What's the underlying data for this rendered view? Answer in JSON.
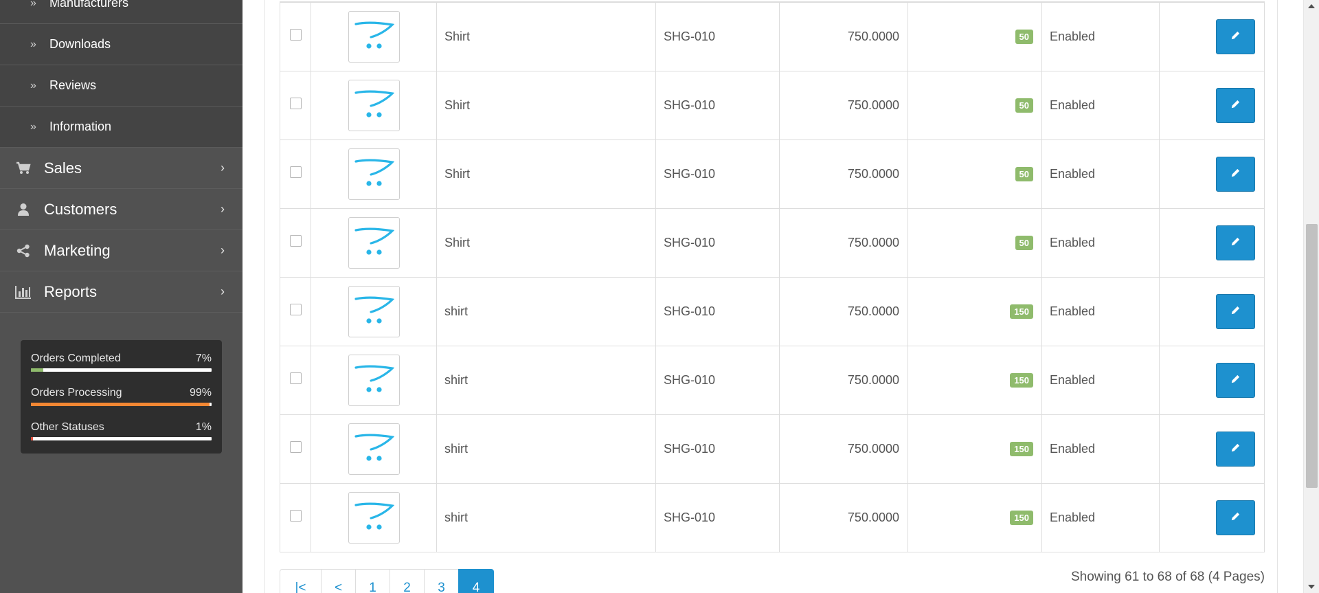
{
  "sidebar": {
    "sub_items": [
      {
        "label": "Manufacturers"
      },
      {
        "label": "Downloads"
      },
      {
        "label": "Reviews"
      },
      {
        "label": "Information"
      }
    ],
    "main_items": [
      {
        "label": "Sales",
        "icon": "shopping-cart-icon"
      },
      {
        "label": "Customers",
        "icon": "user-icon"
      },
      {
        "label": "Marketing",
        "icon": "share-icon"
      },
      {
        "label": "Reports",
        "icon": "bar-chart-icon"
      }
    ],
    "stats": [
      {
        "name": "Orders Completed",
        "pct": "7%",
        "value": 0.07,
        "color": "#8fbb6c"
      },
      {
        "name": "Orders Processing",
        "pct": "99%",
        "value": 0.99,
        "color": "#f38733"
      },
      {
        "name": "Other Statuses",
        "pct": "1%",
        "value": 0.01,
        "color": "#e3503e"
      }
    ]
  },
  "products": [
    {
      "name": "Shirt",
      "model": "SHG-010",
      "price": "750.0000",
      "quantity": "50",
      "status": "Enabled"
    },
    {
      "name": "Shirt",
      "model": "SHG-010",
      "price": "750.0000",
      "quantity": "50",
      "status": "Enabled"
    },
    {
      "name": "Shirt",
      "model": "SHG-010",
      "price": "750.0000",
      "quantity": "50",
      "status": "Enabled"
    },
    {
      "name": "Shirt",
      "model": "SHG-010",
      "price": "750.0000",
      "quantity": "50",
      "status": "Enabled"
    },
    {
      "name": "shirt",
      "model": "SHG-010",
      "price": "750.0000",
      "quantity": "150",
      "status": "Enabled"
    },
    {
      "name": "shirt",
      "model": "SHG-010",
      "price": "750.0000",
      "quantity": "150",
      "status": "Enabled"
    },
    {
      "name": "shirt",
      "model": "SHG-010",
      "price": "750.0000",
      "quantity": "150",
      "status": "Enabled"
    },
    {
      "name": "shirt",
      "model": "SHG-010",
      "price": "750.0000",
      "quantity": "150",
      "status": "Enabled"
    }
  ],
  "pagination": {
    "pages": [
      "|<",
      "<",
      "1",
      "2",
      "3",
      "4"
    ],
    "active": "4",
    "summary": "Showing 61 to 68 of 68 (4 Pages)"
  },
  "colors": {
    "accent": "#1e91cf",
    "badge": "#8fbb6c",
    "sidebar_bg": "#515151",
    "submenu_bg": "#444444"
  }
}
